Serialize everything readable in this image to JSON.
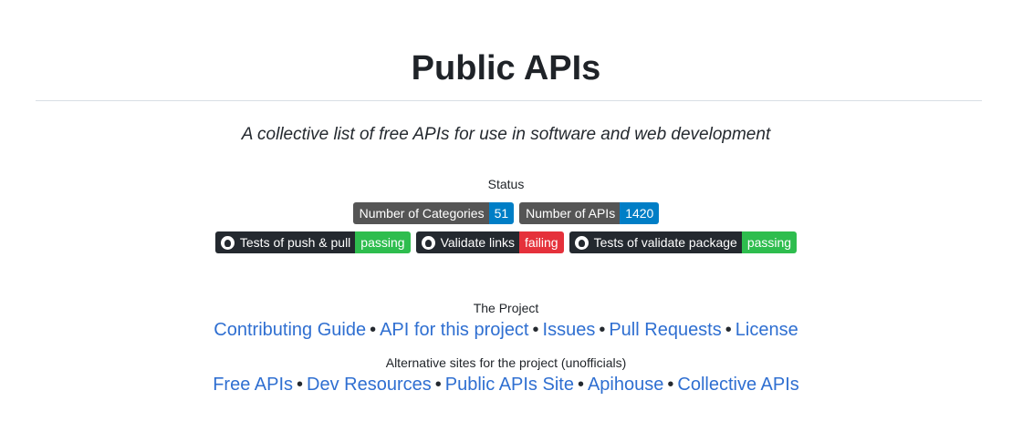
{
  "header": {
    "title": "Public APIs",
    "subtitle": "A collective list of free APIs for use in software and web development"
  },
  "status": {
    "heading": "Status",
    "badges_row1": [
      {
        "label": "Number of Categories",
        "value": "51",
        "value_color": "#007ec6"
      },
      {
        "label": "Number of APIs",
        "value": "1420",
        "value_color": "#007ec6"
      }
    ],
    "badges_row2": [
      {
        "label": "Tests of push & pull",
        "value": "passing",
        "icon": "github-icon",
        "value_color": "#2ebd4e"
      },
      {
        "label": "Validate links",
        "value": "failing",
        "icon": "github-icon",
        "value_color": "#e5313b"
      },
      {
        "label": "Tests of validate package",
        "value": "passing",
        "icon": "github-icon",
        "value_color": "#2ebd4e"
      }
    ]
  },
  "project": {
    "heading": "The Project",
    "links": [
      "Contributing Guide",
      "API for this project",
      "Issues",
      "Pull Requests",
      "License"
    ],
    "separator": "•"
  },
  "alternatives": {
    "heading": "Alternative sites for the project (unofficials)",
    "links": [
      "Free APIs",
      "Dev Resources",
      "Public APIs Site",
      "Apihouse",
      "Collective APIs"
    ]
  },
  "colors": {
    "link": "#2f6fd1",
    "badge_label": "#555555",
    "badge_label_dark": "#24292f"
  }
}
